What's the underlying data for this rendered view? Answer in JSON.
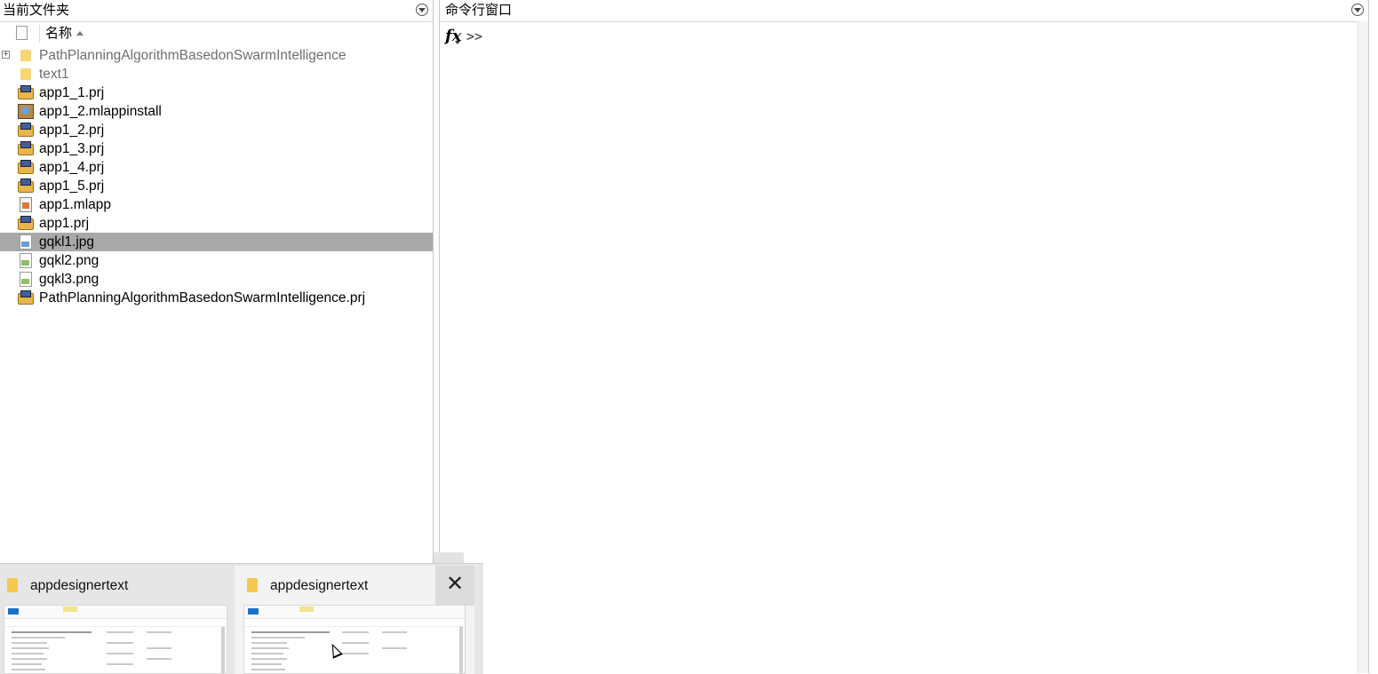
{
  "current_folder": {
    "title": "当前文件夹",
    "column_name": "名称",
    "items": [
      {
        "name": "PathPlanningAlgorithmBasedonSwarmIntelligence",
        "type": "folder",
        "expandable": true
      },
      {
        "name": "text1",
        "type": "folder"
      },
      {
        "name": "app1_1.prj",
        "type": "prj"
      },
      {
        "name": "app1_2.mlappinstall",
        "type": "install"
      },
      {
        "name": "app1_2.prj",
        "type": "prj"
      },
      {
        "name": "app1_3.prj",
        "type": "prj"
      },
      {
        "name": "app1_4.prj",
        "type": "prj"
      },
      {
        "name": "app1_5.prj",
        "type": "prj"
      },
      {
        "name": "app1.mlapp",
        "type": "mlapp"
      },
      {
        "name": "app1.prj",
        "type": "prj"
      },
      {
        "name": "gqkl1.jpg",
        "type": "jpg",
        "selected": true
      },
      {
        "name": "gqkl2.png",
        "type": "png"
      },
      {
        "name": "gqkl3.png",
        "type": "png"
      },
      {
        "name": "PathPlanningAlgorithmBasedonSwarmIntelligence.prj",
        "type": "prj"
      }
    ]
  },
  "command_window": {
    "title": "命令行窗口",
    "fx_label": "fx",
    "prompt": ">>"
  },
  "taskbar_preview": {
    "windows": [
      {
        "title": "appdesignertext"
      },
      {
        "title": "appdesignertext"
      }
    ],
    "close_glyph": "✕"
  },
  "colors": {
    "selected_row": "#a9a9a9",
    "folder_text": "#6e6e6e",
    "folder_icon": "#f7d774"
  }
}
